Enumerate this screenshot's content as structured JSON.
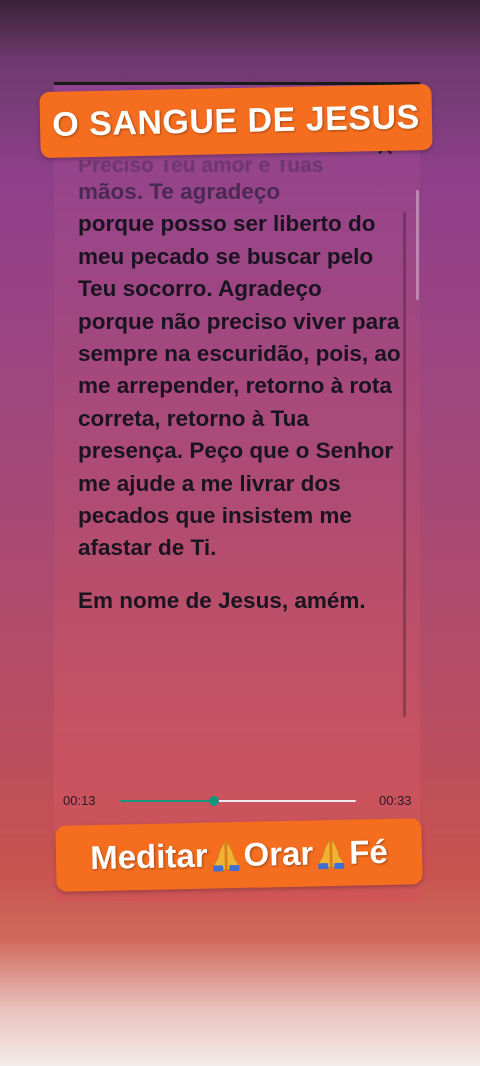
{
  "banner": {
    "title": "O SANGUE DE JESUS"
  },
  "prayer": {
    "faded_top_line": "Preciso Teu amor e Tuas",
    "first_dim": "mãos. Te agradeço",
    "first_rest": "porque posso ser liberto do meu pecado se buscar pelo Teu socorro. Agradeço porque não preciso viver para sempre na escuridão, pois, ao me arrepender, retorno à rota correta, retorno à Tua presença. Peço que o Senhor me ajude a me livrar dos pecados que insistem me afastar de Ti.",
    "second_paragraph": "Em nome de Jesus, amém."
  },
  "player": {
    "current_time": "00:13",
    "total_time": "00:33",
    "progress": 0.4,
    "accent_color": "#17957d"
  },
  "footer": {
    "word1": "Meditar",
    "word2": "Orar",
    "word3": "Fé",
    "separator_icon": "praying-hands-icon"
  },
  "close_icon": "close-icon"
}
